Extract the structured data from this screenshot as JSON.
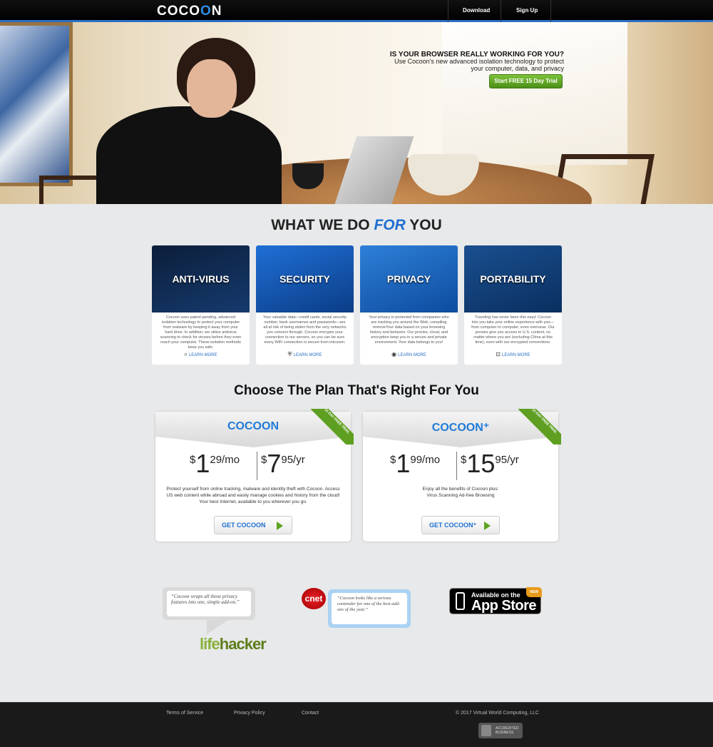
{
  "nav": {
    "logo_a": "COCO",
    "logo_b": "O",
    "logo_c": "N",
    "links": [
      "Download",
      "Sign Up"
    ]
  },
  "hero": {
    "headline": "IS YOUR BROWSER REALLY WORKING FOR YOU?",
    "subline": "Use Cocoon's new advanced isolation technology to protect your computer, data, and privacy",
    "cta": "Start FREE 15 Day Trial"
  },
  "what_we_do": {
    "title_a": "WHAT WE DO",
    "title_em": "FOR",
    "title_b": "YOU",
    "features": [
      {
        "title": "ANTI-VIRUS",
        "text": "Cocoon uses patent-pending, advanced isolation technology to protect your computer from malware by keeping it away from your hard drive. In addition, we utilize antivirus scanning to check for viruses before they even reach your computer. These isolation methods keep you safe.",
        "link": "LEARN MORE",
        "icon": "magnifier-icon"
      },
      {
        "title": "SECURITY",
        "text": "Your valuable data—credit cards, social security number, bank usernames and passwords—are all at risk of being stolen from the very networks you connect through. Cocoon encrypts your connection to our servers, so you can be sure every WiFi connection is secure from intrusion.",
        "link": "LEARN MORE",
        "icon": "shield-icon"
      },
      {
        "title": "PRIVACY",
        "text": "Your privacy is protected from companies who are tracking you around the Web, compiling removeYour data based on your browsing history and behavior. Our proxies, cloud, and encryption keep you in a secure and private environment. Your data belongs to you!",
        "link": "LEARN MORE",
        "icon": "eye-icon"
      },
      {
        "title": "PORTABILITY",
        "text": "Traveling has never been this easy! Cocoon lets you take your online experience with you—from computer to computer, even overseas. Our proxies give you access to U.S. content, no matter where you are (excluding China at this time), even with our encrypted connections.",
        "link": "LEARN MORE",
        "icon": "laptop-icon"
      }
    ]
  },
  "plans": {
    "title": "Choose The Plan That's Right For You",
    "items": [
      {
        "name": "COCOON",
        "ribbon": "15 DAY FREE TRIAL",
        "monthly": {
          "cur": "$",
          "big": "1",
          "sm": "29/mo"
        },
        "yearly": {
          "cur": "$",
          "big": "7",
          "sm": "95/yr"
        },
        "desc": "Protect yourself from online tracking, malware and identity theft with Cocoon. Access US web content while abroad and easily manage cookies and history from the cloud! Your best Internet, available to you wherever you go.",
        "button": "GET COCOON"
      },
      {
        "name": "COCOON⁺",
        "ribbon": "15 DAY FREE TRIAL",
        "monthly": {
          "cur": "$",
          "big": "1",
          "sm": "99/mo"
        },
        "yearly": {
          "cur": "$",
          "big": "15",
          "sm": "95/yr"
        },
        "desc": "Enjoy all the benefits of Cocoon plus: Virus Scanning Ad-free Browsing",
        "button": "GET COCOON⁺"
      }
    ]
  },
  "press": {
    "lifehacker_quote": "“Cocoon wraps all those privacy features into one, simple add-on.”",
    "lifehacker_a": "life",
    "lifehacker_b": "hacker",
    "cnet_logo": "cnet",
    "cnet_quote": "“Cocoon looks like a serious contender for one of the best add-ons of the year.”",
    "app_small": "Available on the",
    "app_big": "App Store",
    "app_new": "NEW"
  },
  "footer": {
    "links": [
      "Terms of Service",
      "Privacy Policy",
      "Contact"
    ],
    "copyright": "© 2017 Virtual World Computing, LLC",
    "bbb": "ACCREDITED BUSINESS"
  },
  "colors": {
    "accent": "#1d6fd0",
    "cta_green": "#5ea321",
    "footer": "#1a1a1a"
  }
}
